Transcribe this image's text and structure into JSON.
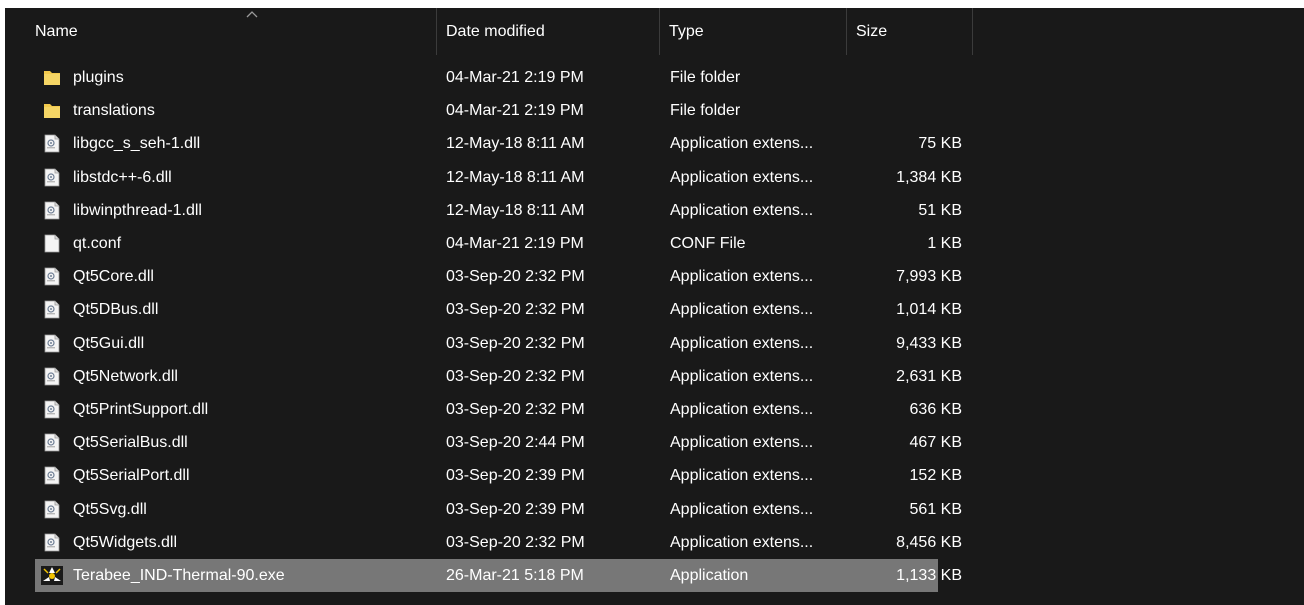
{
  "columns": {
    "name": "Name",
    "date_modified": "Date modified",
    "type": "Type",
    "size": "Size"
  },
  "sort": {
    "column": "Name",
    "direction": "ascending"
  },
  "colors": {
    "background": "#191919",
    "text": "#ffffff",
    "selected_row": "#777777",
    "folder_yellow": "#f2c94c"
  },
  "files": [
    {
      "name": "plugins",
      "date": "04-Mar-21 2:19 PM",
      "type": "File folder",
      "size": "",
      "icon": "folder-icon"
    },
    {
      "name": "translations",
      "date": "04-Mar-21 2:19 PM",
      "type": "File folder",
      "size": "",
      "icon": "folder-icon"
    },
    {
      "name": "libgcc_s_seh-1.dll",
      "date": "12-May-18 8:11 AM",
      "type": "Application extens...",
      "size": "75 KB",
      "icon": "dll-file-icon"
    },
    {
      "name": "libstdc++-6.dll",
      "date": "12-May-18 8:11 AM",
      "type": "Application extens...",
      "size": "1,384 KB",
      "icon": "dll-file-icon"
    },
    {
      "name": "libwinpthread-1.dll",
      "date": "12-May-18 8:11 AM",
      "type": "Application extens...",
      "size": "51 KB",
      "icon": "dll-file-icon"
    },
    {
      "name": "qt.conf",
      "date": "04-Mar-21 2:19 PM",
      "type": "CONF File",
      "size": "1 KB",
      "icon": "blank-file-icon"
    },
    {
      "name": "Qt5Core.dll",
      "date": "03-Sep-20 2:32 PM",
      "type": "Application extens...",
      "size": "7,993 KB",
      "icon": "dll-file-icon"
    },
    {
      "name": "Qt5DBus.dll",
      "date": "03-Sep-20 2:32 PM",
      "type": "Application extens...",
      "size": "1,014 KB",
      "icon": "dll-file-icon"
    },
    {
      "name": "Qt5Gui.dll",
      "date": "03-Sep-20 2:32 PM",
      "type": "Application extens...",
      "size": "9,433 KB",
      "icon": "dll-file-icon"
    },
    {
      "name": "Qt5Network.dll",
      "date": "03-Sep-20 2:32 PM",
      "type": "Application extens...",
      "size": "2,631 KB",
      "icon": "dll-file-icon"
    },
    {
      "name": "Qt5PrintSupport.dll",
      "date": "03-Sep-20 2:32 PM",
      "type": "Application extens...",
      "size": "636 KB",
      "icon": "dll-file-icon"
    },
    {
      "name": "Qt5SerialBus.dll",
      "date": "03-Sep-20 2:44 PM",
      "type": "Application extens...",
      "size": "467 KB",
      "icon": "dll-file-icon"
    },
    {
      "name": "Qt5SerialPort.dll",
      "date": "03-Sep-20 2:39 PM",
      "type": "Application extens...",
      "size": "152 KB",
      "icon": "dll-file-icon"
    },
    {
      "name": "Qt5Svg.dll",
      "date": "03-Sep-20 2:39 PM",
      "type": "Application extens...",
      "size": "561 KB",
      "icon": "dll-file-icon"
    },
    {
      "name": "Qt5Widgets.dll",
      "date": "03-Sep-20 2:32 PM",
      "type": "Application extens...",
      "size": "8,456 KB",
      "icon": "dll-file-icon"
    },
    {
      "name": "Terabee_IND-Thermal-90.exe",
      "date": "26-Mar-21 5:18 PM",
      "type": "Application",
      "size": "1,133 KB",
      "icon": "app-exe-icon",
      "selected": true
    }
  ]
}
